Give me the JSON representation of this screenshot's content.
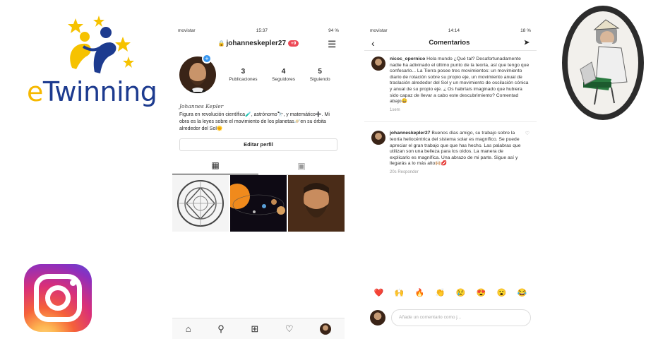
{
  "logos": {
    "etwinning_text_e": "e",
    "etwinning_text_rest": "Twinning"
  },
  "profile_screen": {
    "status": {
      "carrier": "movistar",
      "time": "15:37",
      "battery": "94 %"
    },
    "username": "johanneskepler27",
    "notif_count": "+9",
    "stats": [
      {
        "value": "3",
        "label": "Publicaciones"
      },
      {
        "value": "4",
        "label": "Seguidores"
      },
      {
        "value": "5",
        "label": "Siguiendo"
      }
    ],
    "display_name": "Johannes Kepler",
    "bio": "Figura en revolución científica🧪, astrónomo🔭, y matemático➕. Mi obra es la leyes sobre el movimiento de los planetas🪐en su órbita alrededor del Sol🌞",
    "edit_button": "Editar perfil"
  },
  "comments_screen": {
    "status": {
      "carrier": "movistar",
      "time": "14:14",
      "battery": "18 %"
    },
    "title": "Comentarios",
    "comments": [
      {
        "user": "nicoc_opernico",
        "text": "Hola mundo ¿Qué tal? Desafortunadamente nadie ha adivinado el último punto de la teoría, así que tengo que confesarlo... La Tierra posee tres movimientos: un movimiento diario de rotación sobre su propio eje, un movimiento anual de traslación alrededor del Sol y un movimiento de oscilación cónica y anual de su propio eje. ¿ Os habríais imaginado que hubiera sido capaz de llevar a cabo este descubrimiento? Comentad abajo😄",
        "meta": "1sem"
      },
      {
        "user": "johanneskepler27",
        "text": "Buenos días amigo, su trabajo sobre la teoría heliocéntrica del sistema solar es magnífico. Se puede apreciar el gran trabajo que  que has hecho. Las palabras que utilizan son una belleza para los oídos. La manera de explicarlo es magnífica. Una abrazo de mi parte. Sigue así y llegarás a lo más alto🙌🏼💋",
        "meta": "20s     Responder"
      }
    ],
    "emojis": [
      "❤️",
      "🙌",
      "🔥",
      "👏",
      "😢",
      "😍",
      "😮",
      "😂"
    ],
    "compose_placeholder": "Añade un comentario como j..."
  }
}
